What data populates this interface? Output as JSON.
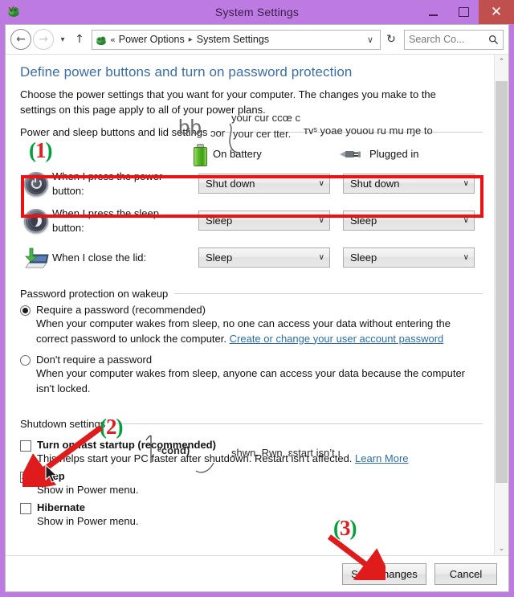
{
  "window": {
    "title": "System Settings",
    "icon": "control-panel-icon",
    "buttons": {
      "minimize": "–",
      "maximize": "□",
      "close": "✕"
    }
  },
  "navbar": {
    "back": "←",
    "forward": "→",
    "recent": "▾",
    "up": "↑",
    "address": {
      "icon": "control-panel-icon",
      "overflow_chevron": "«",
      "segments": [
        "Power Options",
        "System Settings"
      ],
      "separator": "▸",
      "dropdown": "∨"
    },
    "refresh": "↻",
    "search": {
      "placeholder": "Search Co...",
      "icon": "search-icon"
    }
  },
  "page": {
    "title": "Define power buttons and turn on password protection",
    "intro": "Choose the power settings that you want for your computer. The changes you make to the settings on this page apply to all of your power plans.",
    "section_power": "Power and sleep buttons and lid settings",
    "columns": [
      {
        "label": "On battery",
        "icon": "battery-icon"
      },
      {
        "label": "Plugged in",
        "icon": "power-plug-icon"
      }
    ],
    "rows": [
      {
        "icon": "power-button-icon",
        "label": "When I press the power button:",
        "on_battery": "Shut down",
        "plugged_in": "Shut down"
      },
      {
        "icon": "sleep-button-icon",
        "label": "When I press the sleep button:",
        "on_battery": "Sleep",
        "plugged_in": "Sleep"
      },
      {
        "icon": "laptop-lid-icon",
        "label": "When I close the lid:",
        "on_battery": "Sleep",
        "plugged_in": "Sleep"
      }
    ],
    "section_password": "Password protection on wakeup",
    "password_options": [
      {
        "title": "Require a password (recommended)",
        "selected": true,
        "desc": "When your computer wakes from sleep, no one can access your data without entering the correct password to unlock the computer.",
        "link": "Create or change your user account password"
      },
      {
        "title": "Don't require a password",
        "selected": false,
        "desc": "When your computer wakes from sleep, anyone can access your data because the computer isn't locked.",
        "link": ""
      }
    ],
    "section_shutdown": "Shutdown settings",
    "shutdown_options": [
      {
        "title": "Turn on fast startup (recommended)",
        "checked": false,
        "desc": "This helps start your PC faster after shutdown. Restart isn't affected.",
        "link": "Learn More"
      },
      {
        "title": "Sleep",
        "checked": true,
        "desc": "Show in Power menu.",
        "link": ""
      },
      {
        "title": "Hibernate",
        "checked": false,
        "desc": "Show in Power menu.",
        "link": ""
      }
    ]
  },
  "footer": {
    "save": "Save changes",
    "cancel": "Cancel"
  },
  "scrollbar": {
    "up": "⌃",
    "down": "⌄"
  },
  "annotations": {
    "step1": {
      "open": "(",
      "digit": "1",
      "close": ")"
    },
    "step2": {
      "open": "(",
      "digit": "2",
      "close": ")"
    },
    "step3": {
      "open": "(",
      "digit": "3",
      "close": ")"
    },
    "highlight_color": "#ee1111",
    "number_color": "#00a13a"
  },
  "artifacts": {
    "ghost1": "your cur ccœ c",
    "ghost2": "your cer tter.",
    "ghost3": "ᴛvˢ yoae youou ru mu ɱe to",
    "ghost4": "ɔor",
    "ghost5": "bb",
    "ghost6": "ᵉcond)",
    "ghost7": "shwn. Rwn. ɛstart isn’t ı"
  }
}
